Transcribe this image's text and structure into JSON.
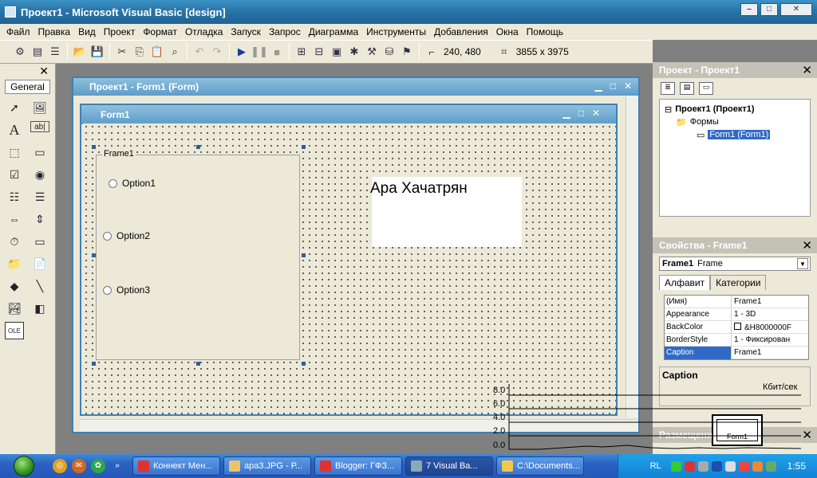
{
  "window": {
    "title": "Проект1 - Microsoft Visual Basic [design]"
  },
  "menu": [
    "Файл",
    "Правка",
    "Вид",
    "Проект",
    "Формат",
    "Отладка",
    "Запуск",
    "Запрос",
    "Диаграмма",
    "Инструменты",
    "Добавления",
    "Окна",
    "Помощь"
  ],
  "toolbar": {
    "position": "240, 480",
    "size": "3855 x 3975"
  },
  "toolbox": {
    "tab": "General"
  },
  "form_window": {
    "title": "Проект1 - Form1 (Form)"
  },
  "inner_form": {
    "title": "Form1"
  },
  "frame": {
    "caption": "Frame1",
    "options": [
      "Option1",
      "Option2",
      "Option3"
    ]
  },
  "label": {
    "text": "Ара Хачатрян"
  },
  "project_panel": {
    "title": "Проект - Проект1",
    "tree": {
      "root": "Проект1 (Проект1)",
      "folder": "Формы",
      "item": "Form1 (Form1)"
    }
  },
  "props_panel": {
    "title": "Свойства - Frame1",
    "object_name": "Frame1",
    "object_type": "Frame",
    "tabs": [
      "Алфавит",
      "Категории"
    ],
    "rows": [
      {
        "name": "(Имя)",
        "value": "Frame1"
      },
      {
        "name": "Appearance",
        "value": "1 - 3D"
      },
      {
        "name": "BackColor",
        "value": "&H8000000F"
      },
      {
        "name": "BorderStyle",
        "value": "1 - Фиксирован"
      },
      {
        "name": "Caption",
        "value": "Frame1"
      }
    ],
    "description": "Caption"
  },
  "layout_panel": {
    "title": "Размещение Формы",
    "form_label": "Form1"
  },
  "overlay_graph": {
    "unit": "Кбит/сек",
    "ticks": [
      "8.0",
      "6.0",
      "4.0",
      "2.0",
      "0.0"
    ]
  },
  "taskbar": {
    "tasks": [
      "Коннект Мен...",
      "ара3.JPG - Р...",
      "Blogger: ГФЗ...",
      "Visual Ba...",
      "C:\\Documents..."
    ],
    "task_prefix_7": "7",
    "lang": "RL",
    "clock": "1:55"
  },
  "colors": {
    "titlebar": "#2a74a8",
    "selection": "#316ac5",
    "taskbar": "#2a62c2"
  }
}
